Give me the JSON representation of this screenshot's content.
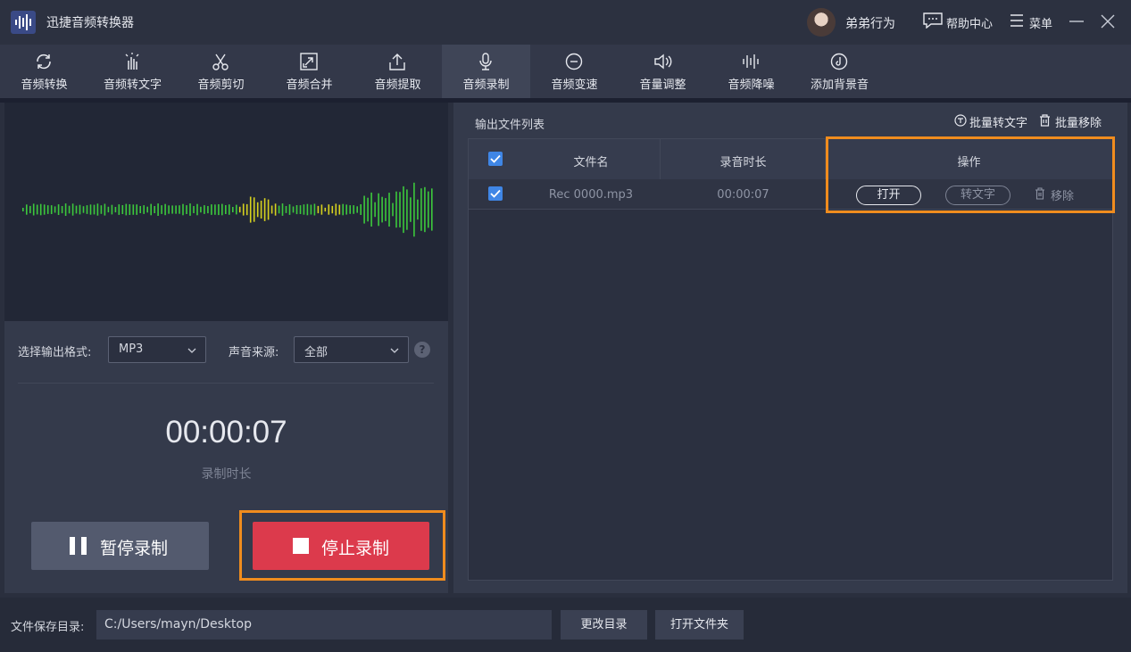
{
  "app": {
    "title": "迅捷音频转换器"
  },
  "header": {
    "user_name": "弟弟行为",
    "help_label": "帮助中心",
    "menu_label": "菜单"
  },
  "toolbar": {
    "items": [
      {
        "label": "音频转换",
        "icon": "refresh-icon"
      },
      {
        "label": "音频转文字",
        "icon": "hand-audio-icon"
      },
      {
        "label": "音频剪切",
        "icon": "scissors-icon"
      },
      {
        "label": "音频合并",
        "icon": "merge-icon"
      },
      {
        "label": "音频提取",
        "icon": "upload-icon"
      },
      {
        "label": "音频录制",
        "icon": "microphone-icon",
        "active": true
      },
      {
        "label": "音频变速",
        "icon": "speed-icon"
      },
      {
        "label": "音量调整",
        "icon": "volume-icon"
      },
      {
        "label": "音频降噪",
        "icon": "denoise-icon"
      },
      {
        "label": "添加背景音",
        "icon": "music-note-icon"
      }
    ]
  },
  "recorder": {
    "format_label": "选择输出格式:",
    "format_value": "MP3",
    "source_label": "声音来源:",
    "source_value": "全部",
    "info_glyph": "?",
    "timer": "00:00:07",
    "timer_label": "录制时长",
    "pause_label": "暂停录制",
    "stop_label": "停止录制"
  },
  "file_list": {
    "title": "输出文件列表",
    "batch_convert_label": "批量转文字",
    "batch_remove_label": "批量移除",
    "columns": [
      "文件名",
      "录音时长",
      "操作"
    ],
    "rows": [
      {
        "file_name": "Rec 0000.mp3",
        "duration": "00:00:07",
        "open_label": "打开",
        "convert_label": "转文字",
        "remove_label": "移除"
      }
    ]
  },
  "footer": {
    "save_dir_label": "文件保存目录:",
    "save_dir_value": "C:/Users/mayn/Desktop",
    "change_dir_label": "更改目录",
    "open_folder_label": "打开文件夹"
  },
  "colors": {
    "accent_blue": "#3f86e6",
    "stop_red": "#dc3a4c",
    "highlight_orange": "#f08c1e",
    "wave_green": "#3cc83c",
    "wave_yellow": "#d6d21e"
  }
}
